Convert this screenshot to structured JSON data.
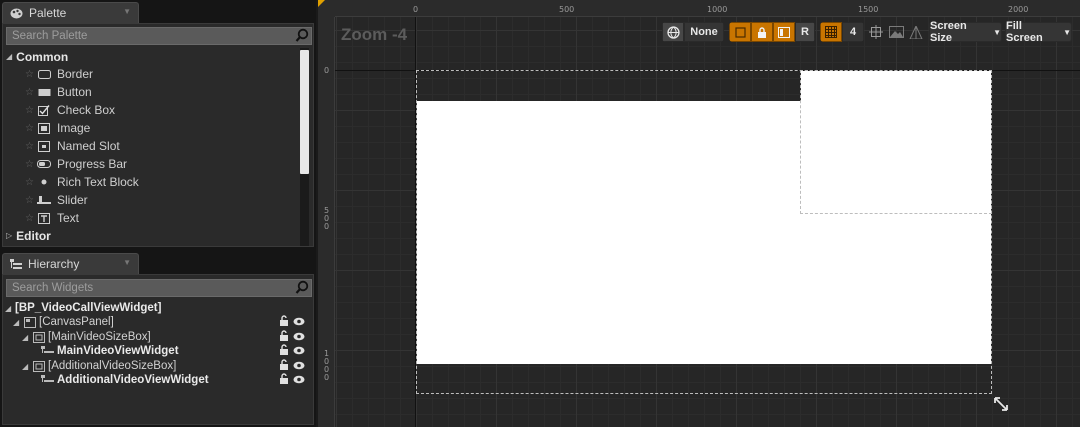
{
  "palette": {
    "tab_title": "Palette",
    "search_placeholder": "Search Palette",
    "category_common": "Common",
    "items": [
      {
        "label": "Border",
        "icon": "border-icon"
      },
      {
        "label": "Button",
        "icon": "button-icon"
      },
      {
        "label": "Check Box",
        "icon": "checkbox-icon"
      },
      {
        "label": "Image",
        "icon": "image-icon"
      },
      {
        "label": "Named Slot",
        "icon": "named-slot-icon"
      },
      {
        "label": "Progress Bar",
        "icon": "progress-bar-icon"
      },
      {
        "label": "Rich Text Block",
        "icon": "dot-icon"
      },
      {
        "label": "Slider",
        "icon": "slider-icon"
      },
      {
        "label": "Text",
        "icon": "text-icon"
      }
    ],
    "category_editor": "Editor"
  },
  "hierarchy": {
    "tab_title": "Hierarchy",
    "search_placeholder": "Search Widgets",
    "root": "[BP_VideoCallViewWidget]",
    "canvas": "[CanvasPanel]",
    "main_size_box": "[MainVideoSizeBox]",
    "main_view": "MainVideoViewWidget",
    "additional_size_box": "[AdditionalVideoSizeBox]",
    "additional_view": "AdditionalVideoViewWidget"
  },
  "designer": {
    "zoom": "Zoom -4",
    "ruler_top": [
      "0",
      "500",
      "1000",
      "1500",
      "2000"
    ],
    "ruler_left": [
      "0",
      "500",
      "1000"
    ],
    "toolbar": {
      "none_label": "None",
      "r_label": "R",
      "grid_count": "4",
      "screen_size_label": "Screen Size",
      "fill_screen_label": "Fill Screen"
    }
  },
  "colors": {
    "accent_orange": "#c97500",
    "canvas_white": "#ffffff",
    "background": "#262626"
  }
}
